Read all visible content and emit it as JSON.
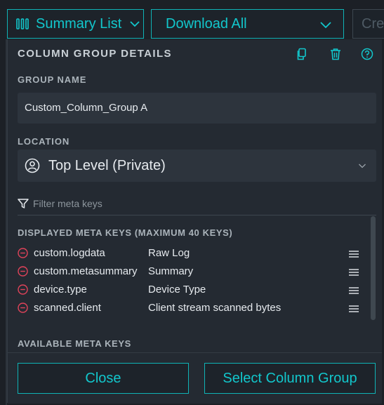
{
  "toolbar": {
    "summary_label": "Summary List",
    "download_label": "Download All",
    "create_label": "Crea"
  },
  "panel": {
    "title": "COLUMN GROUP DETAILS",
    "group_name_label": "GROUP NAME",
    "group_name_value": "Custom_Column_Group A",
    "location_label": "LOCATION",
    "location_value": "Top Level (Private)",
    "filter_placeholder": "Filter meta keys",
    "displayed_label": "DISPLAYED META KEYS (MAXIMUM 40 KEYS)",
    "available_label": "AVAILABLE META KEYS",
    "displayed_keys": [
      {
        "key": "custom.logdata",
        "display": "Raw Log"
      },
      {
        "key": "custom.metasummary",
        "display": "Summary"
      },
      {
        "key": "device.type",
        "display": "Device Type"
      },
      {
        "key": "scanned.client",
        "display": "Client stream scanned bytes"
      }
    ]
  },
  "footer": {
    "close_label": "Close",
    "select_label": "Select Column Group"
  },
  "colors": {
    "accent": "#12c7cc",
    "remove": "#e0435a",
    "panel_bg": "#242a32",
    "field_bg": "#2d343d"
  }
}
